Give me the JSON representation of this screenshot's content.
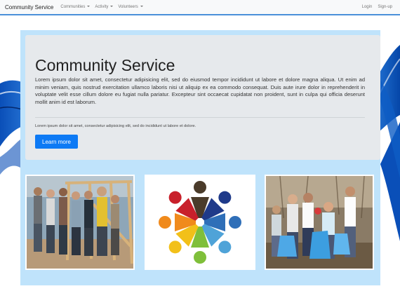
{
  "navbar": {
    "brand": "Community Service",
    "items": [
      {
        "label": "Communities"
      },
      {
        "label": "Activity"
      },
      {
        "label": "Volunteers"
      }
    ],
    "login": "Login",
    "signup": "Sign-up"
  },
  "jumbotron": {
    "title": "Community Service",
    "lead": "Lorem ipsum dolor sit amet, consectetur adipisicing elit, sed do eiusmod tempor incididunt ut labore et dolore magna aliqua. Ut enim ad minim veniam, quis nostrud exercitation ullamco laboris nisi ut aliquip ex ea commodo consequat. Duis aute irure dolor in reprehenderit in voluptate velit esse cillum dolore eu fugiat nulla pariatur. Excepteur sint occaecat cupidatat non proident, sunt in culpa qui officia deserunt mollit anim id est laborum.",
    "small_text": "Lorem ipsum dolor sit amet, consectetur adipisicing elit, sed do incididunt ut labore et dolore.",
    "button_label": "Learn more"
  },
  "colors": {
    "accent": "#0d7af5",
    "panel_background": "#bfe3fb",
    "jumbotron_background": "#e6e9ec",
    "navbar_border": "#4a90d9"
  },
  "cards": [
    {
      "icon": "volunteers-building-frame-photo"
    },
    {
      "icon": "community-circle-logo"
    },
    {
      "icon": "volunteers-cleanup-photo"
    }
  ]
}
